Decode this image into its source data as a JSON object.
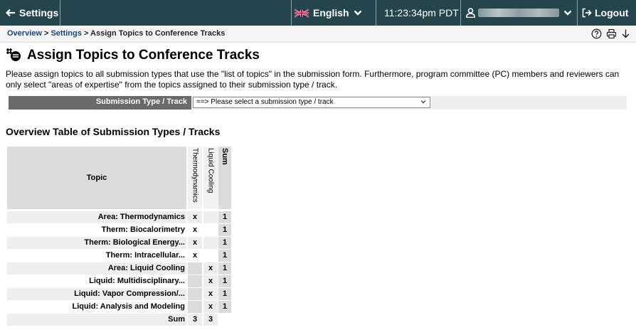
{
  "topbar": {
    "settings_label": "Settings",
    "language_label": "English",
    "time": "11:23:34pm PDT",
    "logout_label": "Logout"
  },
  "breadcrumb": {
    "overview": "Overview",
    "sep1": " > ",
    "settings": "Settings",
    "sep2": " > ",
    "current": "Assign Topics to Conference Tracks"
  },
  "page": {
    "title": "Assign Topics to Conference Tracks",
    "intro": "Please assign topics to all submission types that use the \"list of topics\" in the submission form. Furthermore, program committee (PC) members and reviewers can only select \"areas of expertise\" from the topics assigned to their submission type / track."
  },
  "form": {
    "label": "Submission Type / Track",
    "select_value": "==> Please select a submission type / track"
  },
  "overview": {
    "title": "Overview Table of Submission Types / Tracks",
    "topic_header": "Topic",
    "columns": [
      "Thermodynamics",
      "Liquid Cooling"
    ],
    "sum_header": "Sum",
    "rows": [
      {
        "label": "Area: Thermodynamics",
        "c1": "x",
        "c2": "",
        "sum": "1"
      },
      {
        "label": "Therm: Biocalorimetry",
        "c1": "x",
        "c2": "",
        "sum": "1"
      },
      {
        "label": "Therm: Biological Energy...",
        "c1": "x",
        "c2": "",
        "sum": "1"
      },
      {
        "label": "Therm: Intracellular...",
        "c1": "x",
        "c2": "",
        "sum": "1"
      },
      {
        "label": "Area: Liquid Cooling",
        "c1": "",
        "c2": "x",
        "sum": "1"
      },
      {
        "label": "Liquid: Multidisciplinary...",
        "c1": "",
        "c2": "x",
        "sum": "1"
      },
      {
        "label": "Liquid: Vapor Compression/...",
        "c1": "",
        "c2": "x",
        "sum": "1"
      },
      {
        "label": "Liquid: Analysis and Modeling",
        "c1": "",
        "c2": "x",
        "sum": "1"
      }
    ],
    "sum_row": {
      "label": "Sum",
      "c1": "3",
      "c2": "3"
    }
  }
}
